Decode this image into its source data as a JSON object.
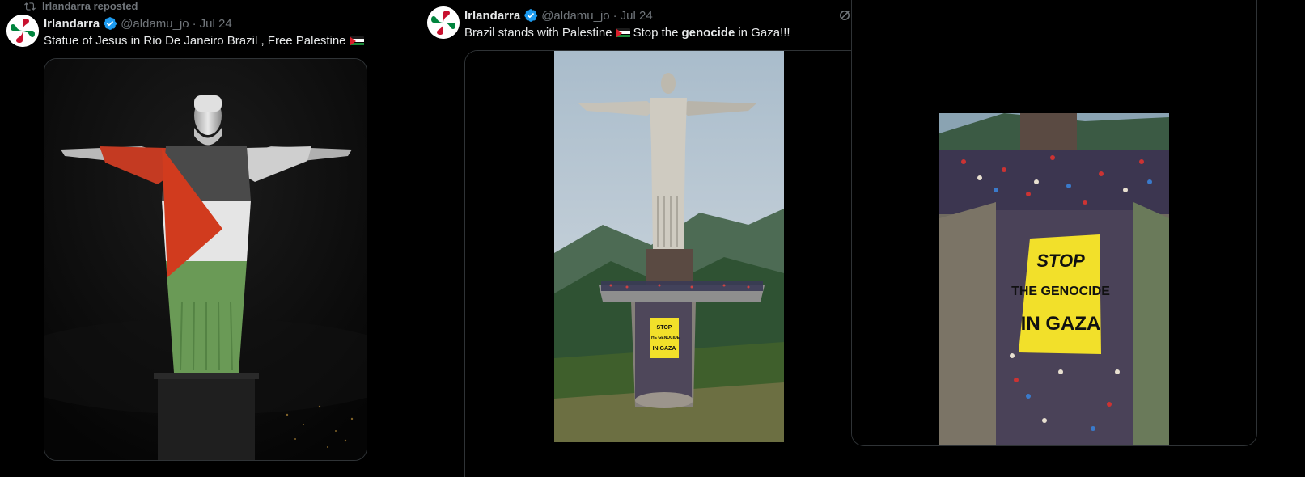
{
  "left_tweet": {
    "repost_label": "Irlandarra reposted",
    "author_name": "Irlandarra",
    "handle": "@aldamu_jo",
    "dot": "·",
    "date": "Jul 24",
    "text": "Statue of Jesus in Rio De Janeiro Brazil , Free Palestine"
  },
  "mid_tweet": {
    "author_name": "Irlandarra",
    "handle": "@aldamu_jo",
    "dot": "·",
    "date": "Jul 24",
    "text_before": "Brazil stands with Palestine",
    "text_stop": "Stop the",
    "text_bold": "genocide",
    "text_after": "in Gaza!!!",
    "banner_lines": [
      "STOP",
      "THE GENOCIDE",
      "IN GAZA"
    ]
  },
  "right_media": {
    "banner_lines": [
      "STOP",
      "THE GENOCIDE",
      "IN GAZA"
    ]
  },
  "colors": {
    "verified": "#1d9bf0",
    "muted": "#71767b",
    "text": "#e7e9ea",
    "border": "#2f3336",
    "banner": "#f2e02a"
  }
}
